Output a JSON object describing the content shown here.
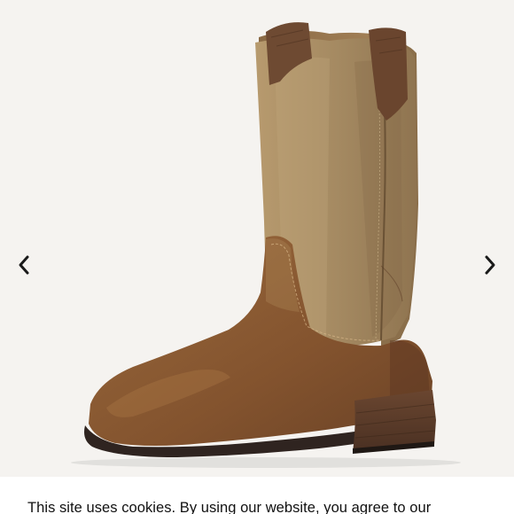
{
  "gallery": {
    "image": {
      "subject": "boot-photo",
      "colors": {
        "background": "#f5f3f0",
        "shaft": "#a98a5f",
        "foot": "#8a5a33",
        "sole": "#3a2d26",
        "heel": "#5a3a28",
        "pull_tab": "#6e4a32"
      }
    },
    "prev_icon": "chevron-left-icon",
    "next_icon": "chevron-right-icon"
  },
  "cookie_banner": {
    "text": "This site uses cookies. By using our website, you agree to our"
  }
}
